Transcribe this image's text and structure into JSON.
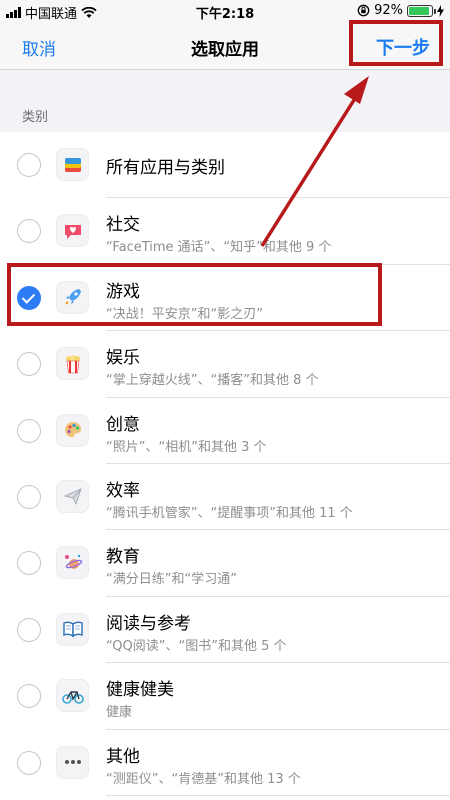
{
  "status_bar": {
    "carrier": "中国联通",
    "time": "下午2:18",
    "battery": "92%",
    "battery_level": 0.92
  },
  "nav": {
    "cancel": "取消",
    "title": "选取应用",
    "next": "下一步"
  },
  "section": {
    "header": "类别"
  },
  "items": [
    {
      "title": "所有应用与类别",
      "subtitle": "",
      "icon": "layers-icon",
      "checked": false
    },
    {
      "title": "社交",
      "subtitle": "“FaceTime 通话”、“知乎”和其他 9 个",
      "icon": "chat-heart-icon",
      "checked": false
    },
    {
      "title": "游戏",
      "subtitle": "“决战！平安京”和“影之刃”",
      "icon": "rocket-icon",
      "checked": true
    },
    {
      "title": "娱乐",
      "subtitle": "“掌上穿越火线”、“播客”和其他 8 个",
      "icon": "popcorn-icon",
      "checked": false
    },
    {
      "title": "创意",
      "subtitle": "“照片”、“相机”和其他 3 个",
      "icon": "palette-icon",
      "checked": false
    },
    {
      "title": "效率",
      "subtitle": "“腾讯手机管家”、“提醒事项”和其他 11 个",
      "icon": "paper-plane-icon",
      "checked": false
    },
    {
      "title": "教育",
      "subtitle": "“满分日练”和“学习通”",
      "icon": "planet-icon",
      "checked": false
    },
    {
      "title": "阅读与参考",
      "subtitle": "“QQ阅读”、“图书”和其他 5 个",
      "icon": "book-icon",
      "checked": false
    },
    {
      "title": "健康健美",
      "subtitle": "健康",
      "icon": "bicycle-icon",
      "checked": false
    },
    {
      "title": "其他",
      "subtitle": "“测距仪”、“肯德基”和其他 13 个",
      "icon": "more-icon",
      "checked": false
    }
  ],
  "colors": {
    "accent": "#1a7cf0",
    "check": "#2d7cf6",
    "annotation": "#b8191b"
  }
}
